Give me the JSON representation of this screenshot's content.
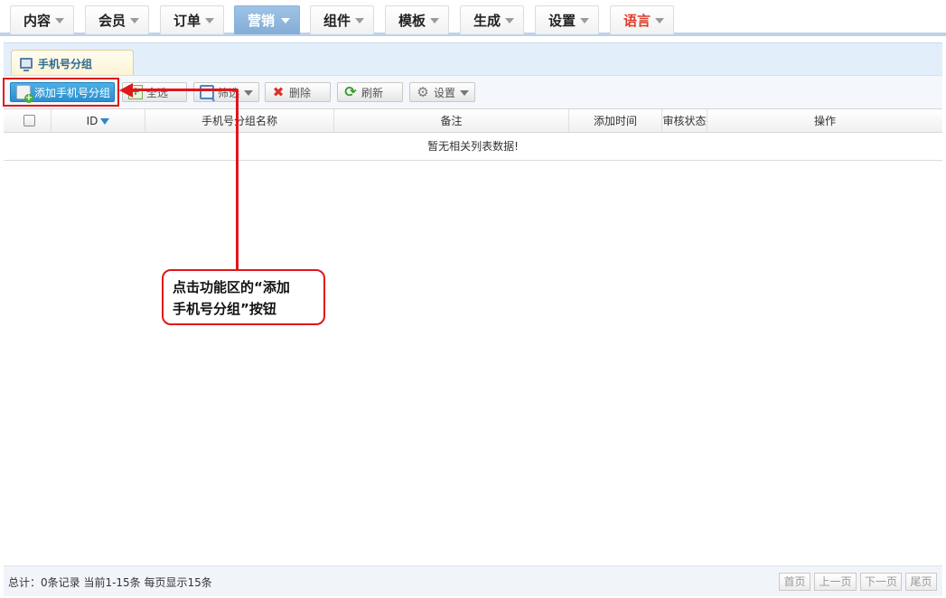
{
  "nav": {
    "items": [
      {
        "label": "内容"
      },
      {
        "label": "会员"
      },
      {
        "label": "订单"
      },
      {
        "label": "营销"
      },
      {
        "label": "组件"
      },
      {
        "label": "模板"
      },
      {
        "label": "生成"
      },
      {
        "label": "设置"
      },
      {
        "label": "语言"
      }
    ],
    "active": "营销",
    "active_color": "#8fb6de",
    "lang_color": "#e03b2c"
  },
  "page_tab": {
    "label": "手机号分组",
    "icon": "monitor-icon"
  },
  "toolbar": {
    "add_label": "添加手机号分组",
    "select_all_label": "全选",
    "filter_label": "筛选",
    "delete_label": "删除",
    "refresh_label": "刷新",
    "settings_label": "设置"
  },
  "table": {
    "columns": [
      "ID",
      "手机号分组名称",
      "备注",
      "添加时间",
      "审核状态",
      "操作"
    ],
    "empty_message": "暂无相关列表数据!"
  },
  "annotation": {
    "line1": "点击功能区的“添加",
    "line2": "手机号分组”按钮",
    "color": "#e0161b"
  },
  "footer": {
    "summary": "总计：0条记录 当前1-15条 每页显示15条",
    "first": "首页",
    "prev": "上一页",
    "next": "下一页",
    "last": "尾页"
  }
}
